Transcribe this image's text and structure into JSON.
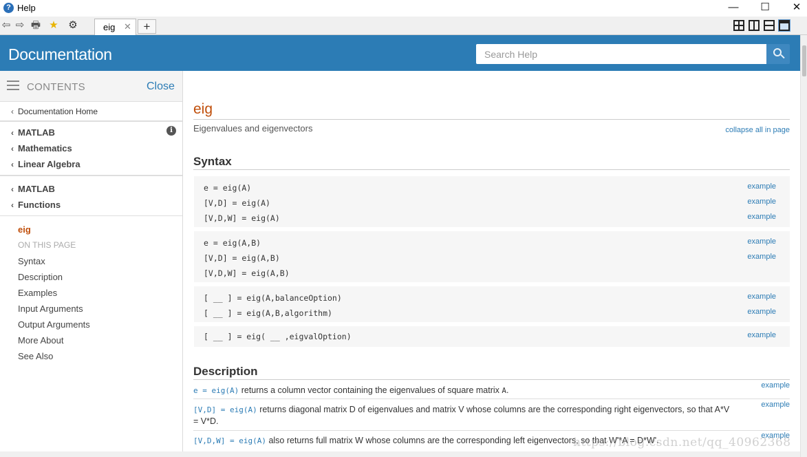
{
  "window": {
    "title": "Help",
    "minimize_glyph": "—",
    "maximize_glyph": "☐",
    "close_glyph": "✕"
  },
  "toolbar": {
    "back_glyph": "⇦",
    "forward_glyph": "⇨",
    "print_glyph": "🖶",
    "favorites_glyph": "★",
    "settings_glyph": "⚙",
    "tab_label": "eig",
    "tab_close_glyph": "✕",
    "new_tab_glyph": "+"
  },
  "header": {
    "title": "Documentation",
    "search_placeholder": "Search Help"
  },
  "sidebar": {
    "contents_label": "CONTENTS",
    "close_label": "Close",
    "home_link": "Documentation Home",
    "breadcrumbs_1": [
      "MATLAB",
      "Mathematics",
      "Linear Algebra"
    ],
    "breadcrumbs_2": [
      "MATLAB",
      "Functions"
    ],
    "current_page": "eig",
    "on_this_page_label": "ON THIS PAGE",
    "toc": [
      "Syntax",
      "Description",
      "Examples",
      "Input Arguments",
      "Output Arguments",
      "More About",
      "See Also"
    ],
    "chevron_glyph": "‹",
    "info_glyph": "i"
  },
  "page": {
    "title": "eig",
    "subtitle": "Eigenvalues and eigenvectors",
    "collapse_all": "collapse all in page",
    "syntax_heading": "Syntax",
    "syntax_groups": [
      [
        {
          "code": "e = eig(A)",
          "link": "example"
        },
        {
          "code": "[V,D] = eig(A)",
          "link": "example"
        },
        {
          "code": "[V,D,W] = eig(A)",
          "link": "example"
        }
      ],
      [
        {
          "code": "e = eig(A,B)",
          "link": "example"
        },
        {
          "code": "[V,D] = eig(A,B)",
          "link": "example"
        },
        {
          "code": "[V,D,W] = eig(A,B)",
          "link": ""
        }
      ],
      [
        {
          "code": "[ __ ] = eig(A,balanceOption)",
          "link": "example"
        },
        {
          "code": "[ __ ] = eig(A,B,algorithm)",
          "link": "example"
        }
      ],
      [
        {
          "code": "[ __ ] = eig( __ ,eigvalOption)",
          "link": "example"
        }
      ]
    ],
    "description_heading": "Description",
    "description": [
      {
        "code": "e = eig(A)",
        "text": " returns a column vector containing the eigenvalues of square matrix ",
        "tail_code": "A",
        "tail": ".",
        "link": "example"
      },
      {
        "code": "[V,D] = eig(A)",
        "text": " returns diagonal matrix D of eigenvalues and matrix V whose columns are the corresponding right eigenvectors, so that A*V = V*D.",
        "tail_code": "",
        "tail": "",
        "link": "example"
      },
      {
        "code": "[V,D,W] = eig(A)",
        "text": " also returns full matrix W whose columns are the corresponding left eigenvectors, so that W'*A = D*W'.",
        "tail_code": "",
        "tail": "",
        "link": "example"
      }
    ]
  },
  "watermark": "https://blog.csdn.net/qq_40962368"
}
